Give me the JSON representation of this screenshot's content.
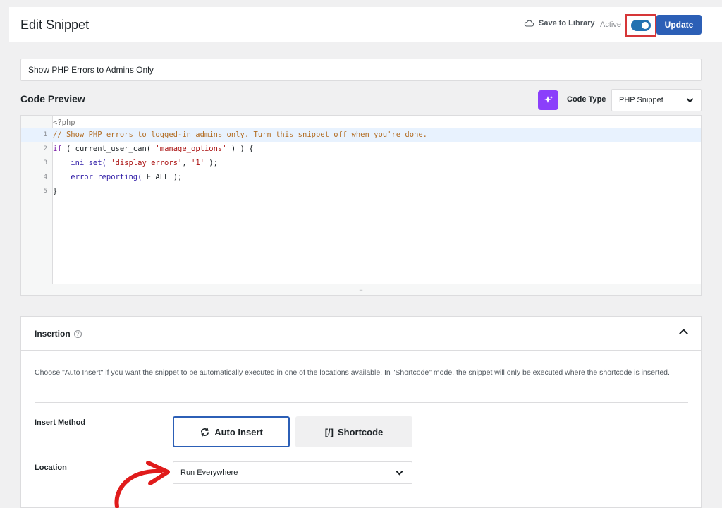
{
  "header": {
    "title": "Edit Snippet",
    "save_to_library": "Save to Library",
    "active_label": "Active",
    "active": true,
    "update_label": "Update"
  },
  "snippet": {
    "title_value": "Show PHP Errors to Admins Only"
  },
  "code_preview": {
    "heading": "Code Preview",
    "code_type_label": "Code Type",
    "code_type_value": "PHP Snippet",
    "php_open_tag": "<?php",
    "line_numbers": [
      "1",
      "2",
      "3",
      "4",
      "5"
    ],
    "lines": {
      "l1_comment": "// Show PHP errors to logged-in admins only. Turn this snippet off when you're done.",
      "l2_if": "if",
      "l2_open": " ( ",
      "l2_fn": "current_user_can(",
      "l2_sp": " ",
      "l2_str": "'manage_options'",
      "l2_close": " ) ) {",
      "l3_indent": "    ",
      "l3_fn": "ini_set(",
      "l3_sp": " ",
      "l3_str1": "'display_errors'",
      "l3_comma": ", ",
      "l3_str2": "'1'",
      "l3_close": " );",
      "l4_indent": "    ",
      "l4_fn": "error_reporting(",
      "l4_rest": " E_ALL );",
      "l5_close": "}"
    },
    "resize_handle": "≡"
  },
  "insertion": {
    "title": "Insertion",
    "help": "?",
    "description": "Choose \"Auto Insert\" if you want the snippet to be automatically executed in one of the locations available. In \"Shortcode\" mode, the snippet will only be executed where the shortcode is inserted.",
    "insert_method_label": "Insert Method",
    "methods": [
      {
        "label": "Auto Insert",
        "icon": "sync-icon",
        "selected": true
      },
      {
        "label": "Shortcode",
        "icon": "shortcode-icon",
        "icon_text": "[/]",
        "selected": false
      }
    ],
    "location_label": "Location",
    "location_value": "Run Everywhere"
  },
  "colors": {
    "accent": "#2c5fb6",
    "toggle_on": "#2271b1",
    "ai_button": "#8b3ffb",
    "highlight_box": "#d63638",
    "annotation_arrow": "#e01b1b"
  }
}
